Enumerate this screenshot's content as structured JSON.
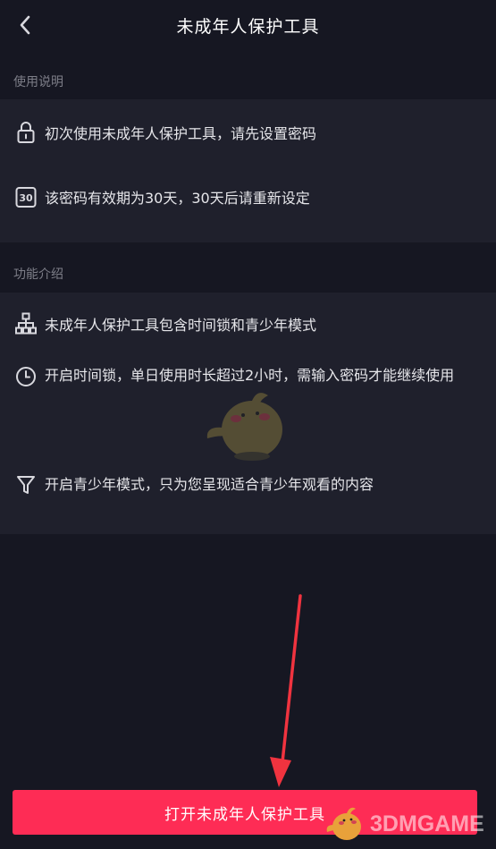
{
  "header": {
    "title": "未成年人保护工具",
    "back_icon": "chevron-left-icon"
  },
  "usage": {
    "label": "使用说明",
    "items": [
      {
        "icon": "lock-icon",
        "text": "初次使用未成年人保护工具，请先设置密码"
      },
      {
        "icon": "calendar-30-icon",
        "icon_text": "30",
        "text": "该密码有效期为30天，30天后请重新设定"
      }
    ]
  },
  "features": {
    "label": "功能介绍",
    "items": [
      {
        "icon": "hierarchy-icon",
        "text": "未成年人保护工具包含时间锁和青少年模式"
      },
      {
        "icon": "clock-icon",
        "text": "开启时间锁，单日使用时长超过2小时，需输入密码才能继续使用"
      },
      {
        "icon": "filter-icon",
        "text": "开启青少年模式，只为您呈现适合青少年观看的内容"
      }
    ]
  },
  "cta": {
    "label": "打开未成年人保护工具"
  },
  "watermark": {
    "text": "3DMGAME"
  },
  "colors": {
    "background": "#161722",
    "card": "#1f202c",
    "accent": "#fe2c55",
    "arrow": "#f0333f"
  }
}
